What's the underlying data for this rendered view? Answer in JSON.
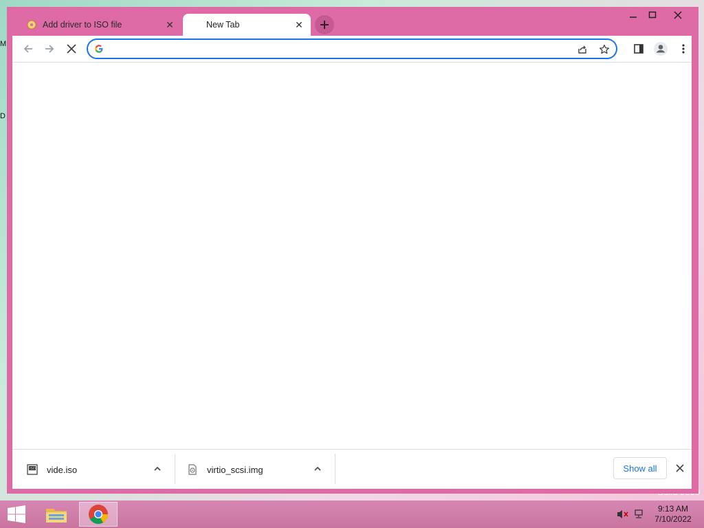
{
  "desktop": {
    "edge_glyph_top": "M",
    "edge_glyph_mid": "D",
    "bottom_text": "Build 9600"
  },
  "browser": {
    "tabs": [
      {
        "title": "Add driver to ISO file",
        "active": false
      },
      {
        "title": "New Tab",
        "active": true
      }
    ],
    "omnibox": {
      "value": "",
      "placeholder": ""
    },
    "colors": {
      "frame": "#de6aa6",
      "accent": "#1a73e8"
    }
  },
  "downloads": {
    "items": [
      {
        "name": "vide.iso",
        "icon": "iso-file-icon"
      },
      {
        "name": "virtio_scsi.img",
        "icon": "disk-image-icon"
      }
    ],
    "show_all_label": "Show all"
  },
  "taskbar": {
    "time": "9:13 AM",
    "date": "7/10/2022",
    "apps": [
      "file-explorer-icon",
      "chrome-icon"
    ]
  }
}
